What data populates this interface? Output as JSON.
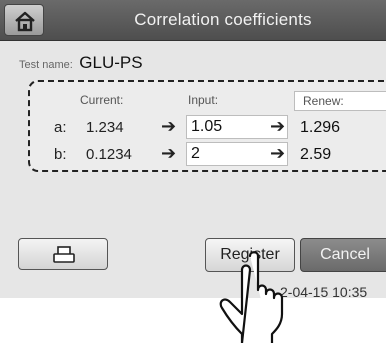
{
  "header": {
    "title": "Correlation coefficients",
    "home_icon": "home-icon"
  },
  "test": {
    "label": "Test name:",
    "value": "GLU-PS"
  },
  "coefficients": {
    "headers": {
      "current": "Current:",
      "input": "Input:",
      "renew": "Renew:"
    },
    "rows": [
      {
        "label": "a:",
        "current": "1.234",
        "input": "1.05",
        "renew": "1.296"
      },
      {
        "label": "b:",
        "current": "0.1234",
        "input": "2",
        "renew": "2.59"
      }
    ],
    "arrow_icon": "arrow-right-icon"
  },
  "buttons": {
    "print_icon": "printer-icon",
    "register": "Register",
    "cancel": "Cancel"
  },
  "status": {
    "datetime": "2-04-15 10:35"
  }
}
